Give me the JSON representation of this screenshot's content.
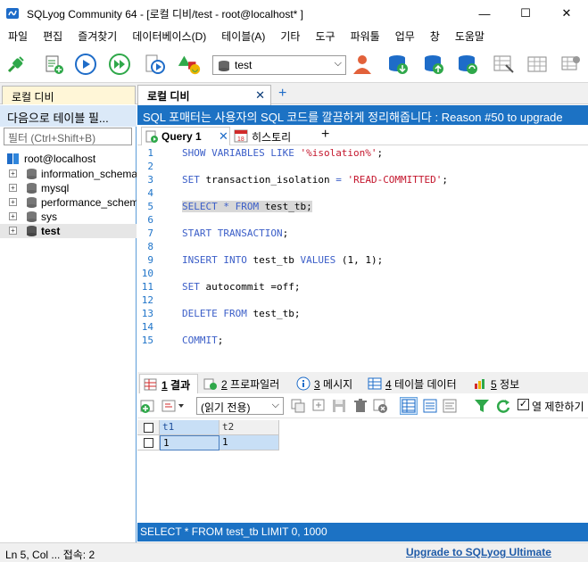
{
  "window": {
    "title": "SQLyog Community 64 - [로컬 디비/test - root@localhost* ]",
    "minimize": "—",
    "maximize": "☐",
    "close": "✕"
  },
  "menu": [
    "파일",
    "편집",
    "즐겨찾기",
    "데이터베이스(D)",
    "테이블(A)",
    "기타",
    "도구",
    "파워툴",
    "업무",
    "창",
    "도움말"
  ],
  "toolbar": {
    "db_select_value": "test",
    "db_select_arrow": "⌵"
  },
  "connection_tabs": [
    {
      "label": "로컬 디비"
    },
    {
      "label": "로컬 디비",
      "close": "✕"
    }
  ],
  "add_tab": "+",
  "left_panel": {
    "header": "다음으로 테이블 필...",
    "filter_placeholder": "필터 (Ctrl+Shift+B)",
    "root": "root@localhost",
    "databases": [
      "information_schema",
      "mysql",
      "performance_schema",
      "sys",
      "test"
    ],
    "expander": "+"
  },
  "banner": "SQL 포매터는 사용자의 SQL 코드를 깔끔하게 정리해줍니다 : Reason #50 to upgrade",
  "editor_tabs": {
    "query": "Query 1",
    "query_close": "✕",
    "history": "히스토리",
    "add": "+"
  },
  "editor": {
    "lines": [
      {
        "n": "1",
        "code": [
          {
            "t": "SHOW VARIABLES LIKE ",
            "c": "kw"
          },
          {
            "t": "'%isolation%'",
            "c": "str"
          },
          {
            "t": ";",
            "c": ""
          }
        ]
      },
      {
        "n": "2",
        "code": []
      },
      {
        "n": "3",
        "code": [
          {
            "t": "SET ",
            "c": "kw"
          },
          {
            "t": "transaction_isolation ",
            "c": ""
          },
          {
            "t": "= ",
            "c": "op"
          },
          {
            "t": "'READ-COMMITTED'",
            "c": "str"
          },
          {
            "t": ";",
            "c": ""
          }
        ]
      },
      {
        "n": "4",
        "code": []
      },
      {
        "n": "5",
        "hl": true,
        "code": [
          {
            "t": "SELECT ",
            "c": "kw"
          },
          {
            "t": "* ",
            "c": "op"
          },
          {
            "t": "FROM ",
            "c": "kw"
          },
          {
            "t": "test_tb;",
            "c": ""
          }
        ]
      },
      {
        "n": "6",
        "code": []
      },
      {
        "n": "7",
        "code": [
          {
            "t": "START TRANSACTION",
            "c": "kw"
          },
          {
            "t": ";",
            "c": ""
          }
        ]
      },
      {
        "n": "8",
        "code": []
      },
      {
        "n": "9",
        "code": [
          {
            "t": "INSERT INTO ",
            "c": "kw"
          },
          {
            "t": "test_tb ",
            "c": ""
          },
          {
            "t": "VALUES ",
            "c": "kw"
          },
          {
            "t": "(1, 1);",
            "c": ""
          }
        ]
      },
      {
        "n": "10",
        "code": []
      },
      {
        "n": "11",
        "code": [
          {
            "t": "SET ",
            "c": "kw"
          },
          {
            "t": "autocommit =off;",
            "c": ""
          }
        ]
      },
      {
        "n": "12",
        "code": []
      },
      {
        "n": "13",
        "code": [
          {
            "t": "DELETE FROM ",
            "c": "kw"
          },
          {
            "t": "test_tb;",
            "c": ""
          }
        ]
      },
      {
        "n": "14",
        "code": []
      },
      {
        "n": "15",
        "code": [
          {
            "t": "COMMIT",
            "c": "kw"
          },
          {
            "t": ";",
            "c": ""
          }
        ]
      }
    ]
  },
  "result_tabs": [
    {
      "num": "1",
      "label": "결과"
    },
    {
      "num": "2",
      "label": "프로파일러"
    },
    {
      "num": "3",
      "label": "메시지"
    },
    {
      "num": "4",
      "label": "테이블 데이터"
    },
    {
      "num": "5",
      "label": "정보"
    }
  ],
  "result_toolbar": {
    "mode_value": "(읽기 전용)",
    "mode_arrow": "⌵",
    "limit_checked": "✓",
    "limit_label": "열 제한하기"
  },
  "grid": {
    "columns": [
      "t1",
      "t2"
    ],
    "rows": [
      [
        "1",
        "1"
      ]
    ]
  },
  "query_status": "SELECT * FROM test_tb LIMIT 0, 1000",
  "status_bar": {
    "position": "Ln 5, Col ...  접속: 2",
    "upgrade": "Upgrade to SQLyog Ultimate"
  }
}
